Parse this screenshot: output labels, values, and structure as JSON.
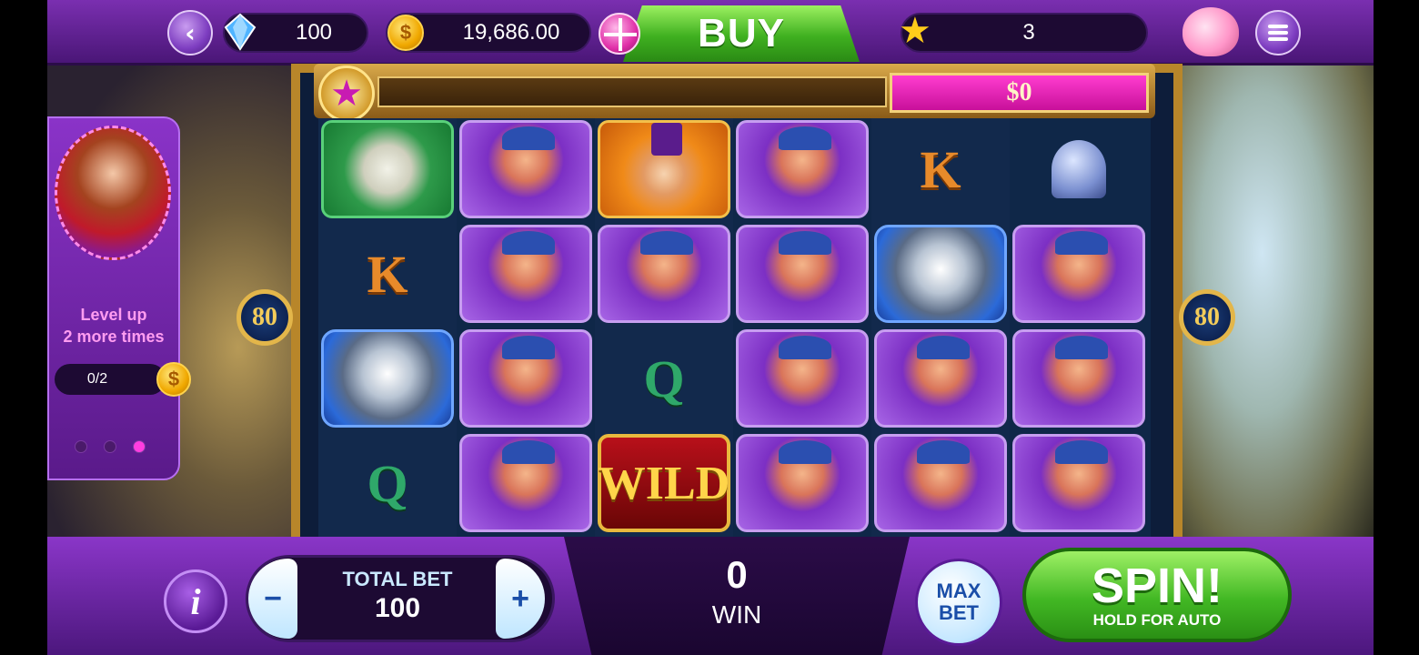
{
  "topbar": {
    "gems": "100",
    "coins": "19,686.00",
    "buy_label": "BUY",
    "stars": "3",
    "gem_icon": "blue-gem-icon",
    "coin_icon": "dollar-coin-icon",
    "gift_icon": "gift-icon",
    "star_icon": "star-icon",
    "piggy_icon": "piggy-bank-icon",
    "menu_icon": "hamburger-menu-icon"
  },
  "jackpot": {
    "value": "$0",
    "progress": 0
  },
  "locks": {
    "left": "80",
    "right": "80"
  },
  "quest": {
    "line1": "Level up",
    "line2": "2 more times",
    "progress": "0/2",
    "progress_fraction": 0,
    "page_index": 3,
    "page_count": 3
  },
  "reels": {
    "columns": [
      [
        "dog",
        "K",
        "train",
        "Q"
      ],
      [
        "lady",
        "lady",
        "lady",
        "lady"
      ],
      [
        "mister",
        "lady",
        "Q",
        "wild"
      ],
      [
        "lady",
        "lady",
        "lady",
        "lady"
      ],
      [
        "K",
        "train",
        "lady",
        "lady"
      ],
      [
        "bell",
        "lady",
        "lady",
        "lady"
      ]
    ],
    "wild_label": "WILD"
  },
  "bottombar": {
    "info_label": "i",
    "minus_label": "−",
    "plus_label": "+",
    "total_bet_label": "TOTAL BET",
    "total_bet_value": "100",
    "win_value": "0",
    "win_label": "WIN",
    "maxbet_line1": "MAX",
    "maxbet_line2": "BET",
    "spin_label": "SPIN!",
    "spin_sub": "HOLD FOR AUTO"
  },
  "colors": {
    "purple_bar": "#7a2fb0",
    "gold_frame": "#b8862a",
    "jackpot_pink": "#ff3dd0",
    "spin_green": "#42b824"
  }
}
